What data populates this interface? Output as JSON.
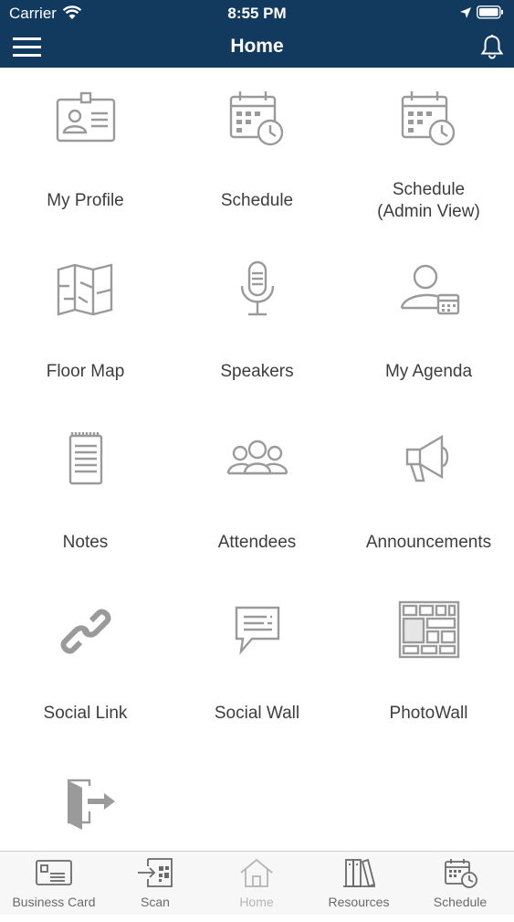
{
  "status_bar": {
    "carrier": "Carrier",
    "time": "8:55 PM"
  },
  "header": {
    "title": "Home"
  },
  "tiles": [
    {
      "label": "My Profile",
      "icon": "profile-card-icon"
    },
    {
      "label": "Schedule",
      "icon": "calendar-clock-icon"
    },
    {
      "label": "Schedule\n(Admin View)",
      "icon": "calendar-clock-icon"
    },
    {
      "label": "Floor Map",
      "icon": "map-icon"
    },
    {
      "label": "Speakers",
      "icon": "microphone-icon"
    },
    {
      "label": "My Agenda",
      "icon": "person-calendar-icon"
    },
    {
      "label": "Notes",
      "icon": "notepad-icon"
    },
    {
      "label": "Attendees",
      "icon": "people-icon"
    },
    {
      "label": "Announcements",
      "icon": "megaphone-icon"
    },
    {
      "label": "Social Link",
      "icon": "chain-link-icon"
    },
    {
      "label": "Social Wall",
      "icon": "chat-bubble-icon"
    },
    {
      "label": "PhotoWall",
      "icon": "photo-grid-icon"
    },
    {
      "label": "",
      "icon": "exit-door-icon"
    }
  ],
  "tabbar": [
    {
      "label": "Business Card",
      "icon": "business-card-icon"
    },
    {
      "label": "Scan",
      "icon": "scan-qr-icon"
    },
    {
      "label": "Home",
      "icon": "home-icon",
      "active": true
    },
    {
      "label": "Resources",
      "icon": "books-icon"
    },
    {
      "label": "Schedule",
      "icon": "calendar-clock-icon"
    }
  ],
  "colors": {
    "header_bg": "#12395e",
    "icon_gray": "#9a9a9a",
    "label": "#3d3d3d"
  }
}
